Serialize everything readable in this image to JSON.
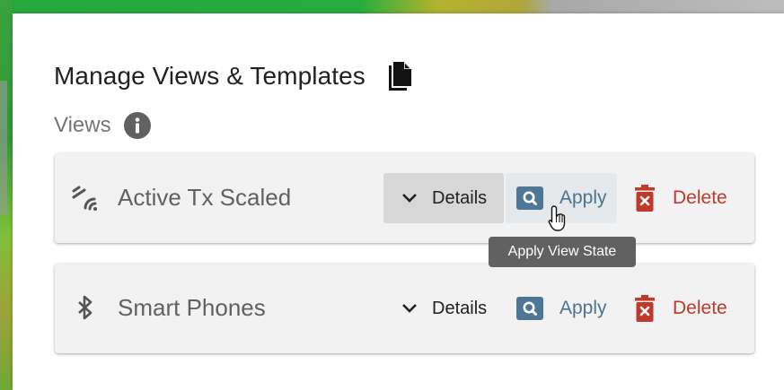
{
  "modal": {
    "title": "Manage Views & Templates",
    "title_icon": "file-copy-icon",
    "section_label": "Views",
    "section_icon": "info-icon"
  },
  "views": [
    {
      "name": "Active Tx Scaled",
      "icon": "wireless-signal-icon",
      "details_label": "Details",
      "apply_label": "Apply",
      "delete_label": "Delete"
    },
    {
      "name": "Smart Phones",
      "icon": "bluetooth-icon",
      "details_label": "Details",
      "apply_label": "Apply",
      "delete_label": "Delete"
    }
  ],
  "tooltip": {
    "text": "Apply View State"
  },
  "colors": {
    "apply_icon_bg": "#4e7796",
    "delete_red": "#c0392b",
    "card_bg": "#f2f2f2",
    "tooltip_bg": "#616161"
  }
}
